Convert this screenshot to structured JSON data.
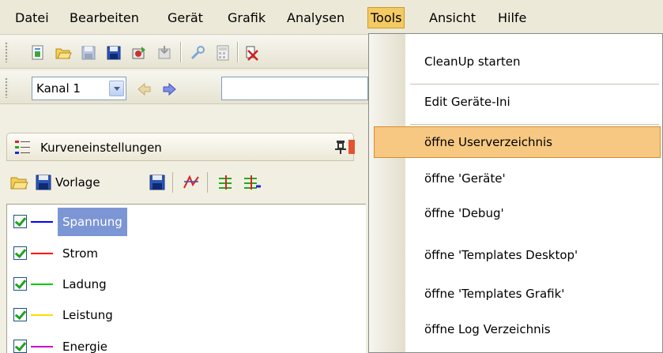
{
  "menubar": {
    "items": [
      {
        "label": "Datei"
      },
      {
        "label": "Bearbeiten"
      },
      {
        "label": "Gerät"
      },
      {
        "label": "Grafik"
      },
      {
        "label": "Analysen"
      },
      {
        "label": "Tools"
      },
      {
        "label": "Ansicht"
      },
      {
        "label": "Hilfe"
      }
    ],
    "active": "Tools"
  },
  "toolbar": {
    "icons": [
      "new-file-icon",
      "open-folder-icon",
      "save-icon",
      "save-as-icon",
      "export-icon",
      "import-icon",
      "tool-icon",
      "calculator-icon",
      "delete-icon"
    ]
  },
  "channel_bar": {
    "channel_value": "Kanal 1",
    "back_icon": "left-arrow-icon",
    "forward_icon": "right-arrow-icon",
    "input_value": ""
  },
  "panel": {
    "title": "Kurveneinstellungen",
    "toolbar_label": "Vorlage",
    "curves": [
      {
        "label": "Spannung",
        "color": "#0000ff",
        "checked": true,
        "selected": true
      },
      {
        "label": "Strom",
        "color": "#ff0000",
        "checked": true,
        "selected": false
      },
      {
        "label": "Ladung",
        "color": "#00cc00",
        "checked": true,
        "selected": false
      },
      {
        "label": "Leistung",
        "color": "#ffdd00",
        "checked": true,
        "selected": false
      },
      {
        "label": "Energie",
        "color": "#cc00cc",
        "checked": true,
        "selected": false
      }
    ]
  },
  "tools_menu": {
    "items": [
      {
        "label": "CleanUp starten"
      },
      {
        "label": "Edit Geräte-Ini"
      },
      {
        "label": "öffne Userverzeichnis"
      },
      {
        "label": "öffne 'Geräte'"
      },
      {
        "label": "öffne 'Debug'"
      },
      {
        "label": "öffne 'Templates Desktop'"
      },
      {
        "label": "öffne 'Templates Grafik'"
      },
      {
        "label": "öffne Log Verzeichnis"
      }
    ],
    "highlighted": "öffne Userverzeichnis"
  },
  "colors": {
    "menu_highlight": "#f4ca62",
    "item_hover": "#f6c882",
    "selection": "#7c95d5"
  }
}
